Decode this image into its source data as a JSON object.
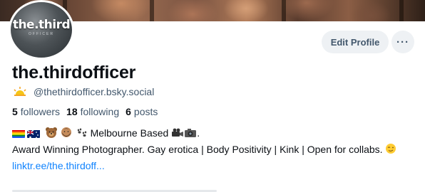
{
  "profile": {
    "avatar_text": "the.third",
    "avatar_sub": "OFFICER",
    "display_name": "the.thirdofficer",
    "handle": "@thethirdofficer.bsky.social",
    "handle_icon": "sun-icon"
  },
  "actions": {
    "edit_profile_label": "Edit Profile",
    "more_label": "···"
  },
  "stats": {
    "followers_count": "5",
    "followers_label": "followers",
    "following_count": "18",
    "following_label": "following",
    "posts_count": "6",
    "posts_label": "posts"
  },
  "bio": {
    "line1_text": "Melbourne Based",
    "line1_emojis_before": [
      "rainbow-flag-icon",
      "australia-flag-icon",
      "bear-icon",
      "bearded-man-icon",
      "paw-prints-icon"
    ],
    "line1_emojis_after": [
      "movie-camera-icon",
      "camera-icon"
    ],
    "line1_end": ".",
    "line2": "Award Winning Photographer. Gay erotica | Body Positivity | Kink | Open for collabs.",
    "line2_emoji": "wink-icon",
    "link": "linktr.ee/the.thirdoff..."
  },
  "colors": {
    "accent_link": "#1083fe",
    "muted_text": "#42576c",
    "button_bg": "#eef1f4"
  }
}
